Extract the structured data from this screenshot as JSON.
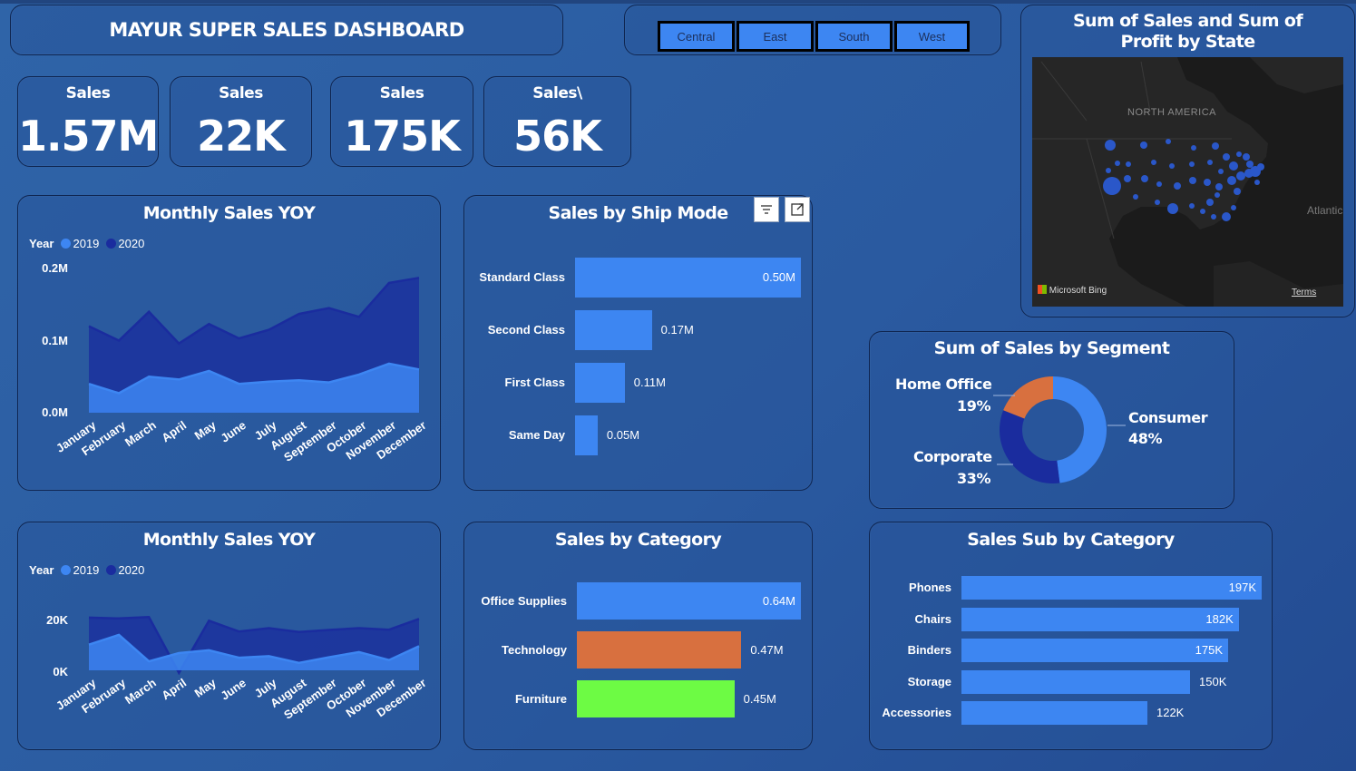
{
  "header": {
    "title": "MAYUR SUPER SALES DASHBOARD"
  },
  "slicer": {
    "regions": [
      "Central",
      "East",
      "South",
      "West"
    ]
  },
  "kpis": [
    {
      "label": "Sales",
      "value": "1.57M"
    },
    {
      "label": "Sales",
      "value": "22K"
    },
    {
      "label": "Sales",
      "value": "175K"
    },
    {
      "label": "Sales\\",
      "value": "56K"
    }
  ],
  "map": {
    "title": "Sum of Sales and Sum of Profit by State",
    "region_label": "NORTH AMERICA",
    "ocean_label": "Atlantic",
    "attribution": "Microsoft Bing",
    "terms": "Terms",
    "colors": {
      "map_bg": "#1a1a1a",
      "bubble": "#2a57c9"
    }
  },
  "colors": {
    "series_2019": "#3d86f2",
    "series_2020": "#1a2c9e",
    "bar_primary": "#3d86f2",
    "bar_technology": "#d8703f",
    "bar_furniture": "#6dfb44",
    "donut_consumer": "#3d86f2",
    "donut_corporate": "#1a2c9e",
    "donut_home_office": "#d8703f"
  },
  "chart_data": [
    {
      "id": "monthly_sales_yoy_1",
      "type": "area",
      "title": "Monthly Sales YOY",
      "legend_title": "Year",
      "legend_position": "top-left",
      "x": [
        "January",
        "February",
        "March",
        "April",
        "May",
        "June",
        "July",
        "August",
        "September",
        "October",
        "November",
        "December"
      ],
      "y_ticks": [
        "0.0M",
        "0.1M",
        "0.2M"
      ],
      "ylim": [
        0,
        0.2
      ],
      "series": [
        {
          "name": "2019",
          "values": [
            0.04,
            0.027,
            0.05,
            0.046,
            0.058,
            0.04,
            0.043,
            0.045,
            0.042,
            0.053,
            0.068,
            0.06
          ]
        },
        {
          "name": "2020",
          "values": [
            0.12,
            0.1,
            0.14,
            0.096,
            0.123,
            0.103,
            0.115,
            0.137,
            0.145,
            0.133,
            0.18,
            0.187
          ]
        }
      ]
    },
    {
      "id": "sales_by_ship_mode",
      "type": "bar",
      "orientation": "horizontal",
      "title": "Sales by Ship Mode",
      "categories": [
        "Standard Class",
        "Second Class",
        "First Class",
        "Same Day"
      ],
      "values": [
        0.5,
        0.17,
        0.11,
        0.05
      ],
      "value_labels": [
        "0.50M",
        "0.17M",
        "0.11M",
        "0.05M"
      ]
    },
    {
      "id": "monthly_sales_yoy_2",
      "type": "area",
      "title": "Monthly Sales YOY",
      "legend_title": "Year",
      "legend_position": "top-left",
      "x": [
        "January",
        "February",
        "March",
        "April",
        "May",
        "June",
        "July",
        "August",
        "September",
        "October",
        "November",
        "December"
      ],
      "y_ticks": [
        "0K",
        "20K"
      ],
      "ylim": [
        0,
        30
      ],
      "series": [
        {
          "name": "2019",
          "values": [
            10.0,
            13.8,
            3.5,
            6.7,
            7.8,
            4.9,
            5.5,
            2.9,
            5.1,
            7.1,
            4.0,
            9.4
          ]
        },
        {
          "name": "2020",
          "values": [
            20.5,
            20.2,
            20.7,
            -1.0,
            19.3,
            15.1,
            16.4,
            14.9,
            15.7,
            16.4,
            15.8,
            20.0
          ]
        }
      ]
    },
    {
      "id": "sales_by_category",
      "type": "bar",
      "orientation": "horizontal",
      "title": "Sales by Category",
      "categories": [
        "Office Supplies",
        "Technology",
        "Furniture"
      ],
      "values": [
        0.64,
        0.47,
        0.45
      ],
      "value_labels": [
        "0.64M",
        "0.47M",
        "0.45M"
      ]
    },
    {
      "id": "sum_of_sales_by_segment",
      "type": "pie",
      "title": "Sum of Sales by Segment",
      "categories": [
        "Consumer",
        "Corporate",
        "Home Office"
      ],
      "values": [
        48,
        33,
        19
      ],
      "value_labels": [
        "48%",
        "33%",
        "19%"
      ]
    },
    {
      "id": "sales_sub_by_category",
      "type": "bar",
      "orientation": "horizontal",
      "title": "Sales Sub by Category",
      "categories": [
        "Phones",
        "Chairs",
        "Binders",
        "Storage",
        "Accessories"
      ],
      "values": [
        197,
        182,
        175,
        150,
        122
      ],
      "value_labels": [
        "197K",
        "182K",
        "175K",
        "150K",
        "122K"
      ]
    }
  ]
}
